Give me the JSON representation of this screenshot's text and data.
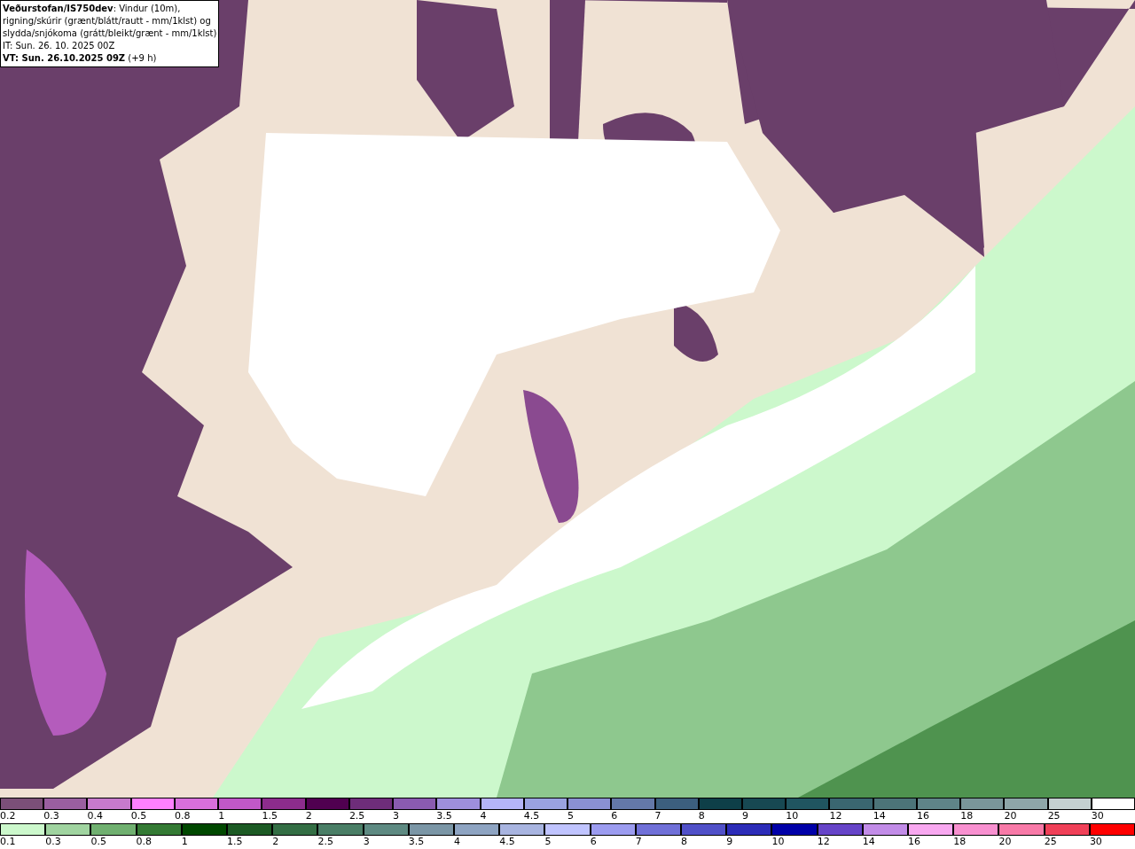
{
  "title_box": {
    "lines": [
      "**Veðurstofan/IS750dev**: Vindur (10m),",
      "rigning/skúrir (grænt/blátt/rautt - mm/1klst) og",
      "slydda/snjókoma (grátt/bleikt/grænt - mm/1klst)",
      "IT: Sun. 26. 10. 2025 00Z",
      "**VT: Sun. 26.10.2025 09Z** (+9 h)"
    ]
  },
  "legends": [
    {
      "items": [
        {
          "label": "0.2",
          "color": "#7b4f78"
        },
        {
          "label": "0.3",
          "color": "#9a5fa0"
        },
        {
          "label": "0.4",
          "color": "#c77acc"
        },
        {
          "label": "0.5",
          "color": "#ff80ff"
        },
        {
          "label": "0.8",
          "color": "#d86fdc"
        },
        {
          "label": "1",
          "color": "#c058c8"
        },
        {
          "label": "1.5",
          "color": "#8c2c8c"
        },
        {
          "label": "2",
          "color": "#500050"
        },
        {
          "label": "2.5",
          "color": "#6e2d7a"
        },
        {
          "label": "3",
          "color": "#8a5bb0"
        },
        {
          "label": "3.5",
          "color": "#9e8fdc"
        },
        {
          "label": "4",
          "color": "#b4b4f8"
        },
        {
          "label": "4.5",
          "color": "#9aa2e0"
        },
        {
          "label": "5",
          "color": "#8a90d2"
        },
        {
          "label": "6",
          "color": "#6478a8"
        },
        {
          "label": "7",
          "color": "#3c5f7e"
        },
        {
          "label": "8",
          "color": "#0e3f48"
        },
        {
          "label": "9",
          "color": "#174852"
        },
        {
          "label": "10",
          "color": "#205560"
        },
        {
          "label": "12",
          "color": "#3a6670"
        },
        {
          "label": "14",
          "color": "#4c7478"
        },
        {
          "label": "16",
          "color": "#5f8488"
        },
        {
          "label": "18",
          "color": "#7a969a"
        },
        {
          "label": "20",
          "color": "#8ea6a8"
        },
        {
          "label": "25",
          "color": "#c4d0d0"
        },
        {
          "label": "30",
          "color": "#ffffff"
        }
      ]
    },
    {
      "items": [
        {
          "label": "0.1",
          "color": "#ccf8cc"
        },
        {
          "label": "0.3",
          "color": "#a0d4a0"
        },
        {
          "label": "0.5",
          "color": "#70b070"
        },
        {
          "label": "0.8",
          "color": "#347a34"
        },
        {
          "label": "1",
          "color": "#004800"
        },
        {
          "label": "1.5",
          "color": "#1c5a24"
        },
        {
          "label": "2",
          "color": "#336e44"
        },
        {
          "label": "2.5",
          "color": "#4a7e66"
        },
        {
          "label": "3",
          "color": "#5e8a82"
        },
        {
          "label": "3.5",
          "color": "#7b96a6"
        },
        {
          "label": "4",
          "color": "#8ea4c2"
        },
        {
          "label": "4.5",
          "color": "#a8b4e0"
        },
        {
          "label": "5",
          "color": "#c0c4ff"
        },
        {
          "label": "6",
          "color": "#9c9cf0"
        },
        {
          "label": "7",
          "color": "#7070d8"
        },
        {
          "label": "8",
          "color": "#5050c8"
        },
        {
          "label": "9",
          "color": "#2c2cb8"
        },
        {
          "label": "10",
          "color": "#0000a8"
        },
        {
          "label": "12",
          "color": "#6644c8"
        },
        {
          "label": "14",
          "color": "#c28ce8"
        },
        {
          "label": "16",
          "color": "#f8a8f0"
        },
        {
          "label": "18",
          "color": "#f890d0"
        },
        {
          "label": "20",
          "color": "#f87aa8"
        },
        {
          "label": "25",
          "color": "#f04058"
        },
        {
          "label": "30",
          "color": "#ff0000"
        }
      ]
    }
  ]
}
